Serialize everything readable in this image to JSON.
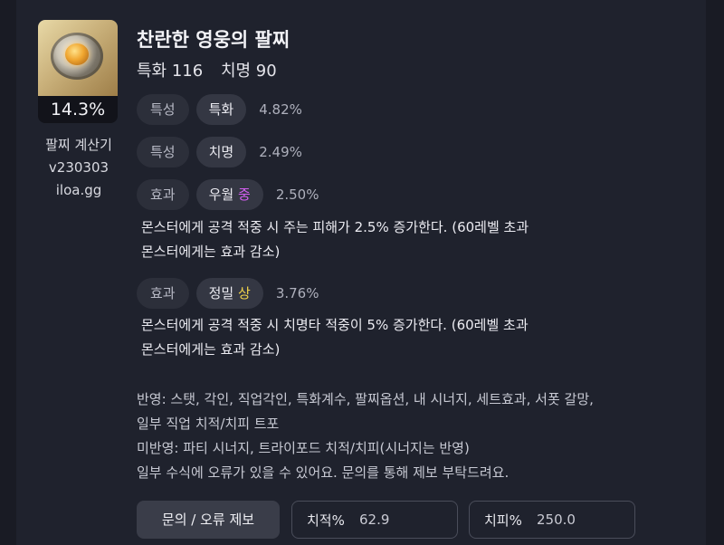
{
  "item": {
    "name": "찬란한 영웅의 팔찌",
    "stat1": "특화 116",
    "stat2": "치명 90",
    "score": "14.3%"
  },
  "calculator": {
    "name": "팔찌 계산기",
    "version": "v230303",
    "site": "iloa.gg"
  },
  "rows": [
    {
      "type": "특성",
      "name": "특화",
      "grade": "",
      "value": "4.82%"
    },
    {
      "type": "특성",
      "name": "치명",
      "grade": "",
      "value": "2.49%"
    },
    {
      "type": "효과",
      "name": "우월",
      "grade": "중",
      "value": "2.50%",
      "desc1": "몬스터에게 공격 적중 시 주는 피해가 2.5% 증가한다. (60레벨 초과",
      "desc2": "몬스터에게는 효과 감소)"
    },
    {
      "type": "효과",
      "name": "정밀",
      "grade": "상",
      "value": "3.76%",
      "desc1": "몬스터에게 공격 적중 시 치명타 적중이 5% 증가한다. (60레벨 초과",
      "desc2": "몬스터에게는 효과 감소)"
    }
  ],
  "grade_colors": {
    "중": "#d35ef0",
    "상": "#f1d34a"
  },
  "notes": [
    "반영: 스탯, 각인, 직업각인, 특화계수, 팔찌옵션, 내 시너지, 세트효과, 서폿 갈망,",
    "일부 직업 치적/치피 트포",
    "미반영: 파티 시너지, 트라이포드 치적/치피(시너지는 반영)",
    "일부 수식에 오류가 있을 수 있어요. 문의를 통해 제보 부탁드려요."
  ],
  "footer": {
    "report_label": "문의 / 오류 제보",
    "crit_rate_label": "치적%",
    "crit_rate_value": "62.9",
    "crit_dmg_label": "치피%",
    "crit_dmg_value": "250.0"
  }
}
